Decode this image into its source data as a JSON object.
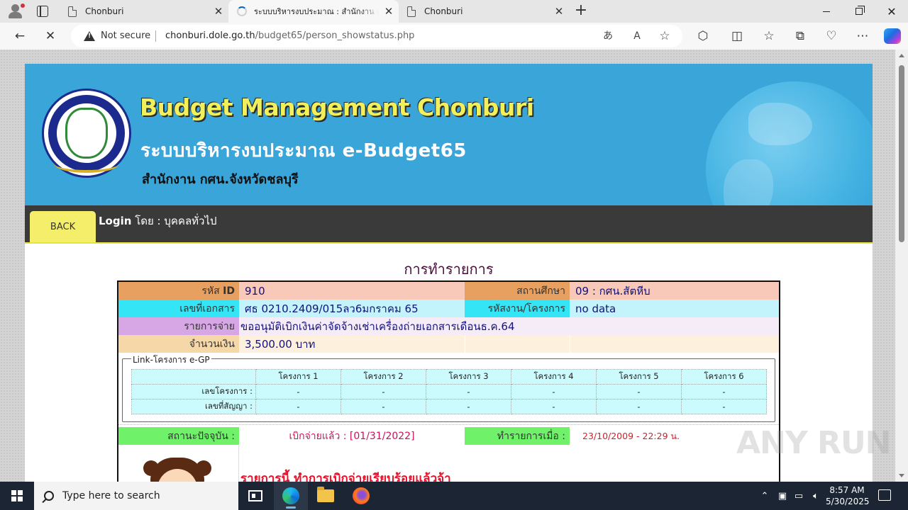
{
  "browser": {
    "tabs": [
      {
        "title": "Chonburi",
        "active": false
      },
      {
        "title": "ระบบบริหารงบประมาณ : สำนักงาน กศน.จังหวัดชลบุรี",
        "active": true
      },
      {
        "title": "Chonburi",
        "active": false
      }
    ],
    "new_tab": "+",
    "address": {
      "security_label": "Not secure",
      "url_host": "chonburi.dole.go.th",
      "url_path": "/budget65/person_showstatus.php"
    },
    "toolbar_icons": [
      "back-icon",
      "stop-icon",
      "read-aloud-icon",
      "immersive-reader-icon",
      "favorite-star-icon",
      "extensions-icon",
      "split-screen-icon",
      "favorites-icon",
      "collections-icon",
      "performance-icon",
      "more-icon",
      "copilot-icon"
    ]
  },
  "site": {
    "title_en": "Budget Management Chonburi",
    "title_th": "ระบบบริหารงบประมาณ e-Budget65",
    "office": "สำนักงาน กศน.จังหวัดชลบุรี",
    "back_label": "BACK",
    "login_label": "Login",
    "login_rest": " โดย : บุคคลทั่วไป",
    "heading": "การทำรายการ"
  },
  "record": {
    "id_label": "รหัส",
    "id_label_strong": "ID",
    "id_value": "910",
    "school_label": "สถานศึกษา",
    "school_value": "09 : กศน.สัตหีบ",
    "doc_label": "เลขที่เอกสาร",
    "doc_value": "ศธ 0210.2409/015ลว6มกราคม 65",
    "project_label": "รหัสงาน/โครงการ",
    "project_value": "no data",
    "expense_label": "รายการจ่าย",
    "expense_value": "ขออนุมัติเบิกเงินค่าจัดจ้างเช่าเครื่องถ่ายเอกสารเดือนธ.ค.64",
    "amount_label": "จำนวนเงิน",
    "amount_value": "3,500.00  บาท"
  },
  "egp": {
    "legend": "Link-โครงการ e-GP",
    "columns": [
      "โครงการ 1",
      "โครงการ 2",
      "โครงการ 3",
      "โครงการ 4",
      "โครงการ 5",
      "โครงการ 6"
    ],
    "rows": [
      {
        "label": "เลขโครงการ :",
        "values": [
          "-",
          "-",
          "-",
          "-",
          "-",
          "-"
        ]
      },
      {
        "label": "เลขที่สัญญา :",
        "values": [
          "-",
          "-",
          "-",
          "-",
          "-",
          "-"
        ]
      }
    ]
  },
  "status": {
    "current_label": "สถานะปัจจุบัน :",
    "current_value": "เบิกจ่ายแล้ว : [01/31/2022]",
    "done_label": "ทำรายการเมื่อ :",
    "done_value": "23/10/2009 - 22:29  น.",
    "message": "รายการนี้ ทำการเบิกจ่ายเรียบร้อยแล้วจ้า"
  },
  "watermark": "ANY RUN",
  "taskbar": {
    "search_placeholder": "Type here to search",
    "time": "8:57 AM",
    "date": "5/30/2025"
  },
  "colors": {
    "banner": "#3aa5d9",
    "title_yellow": "#f2f05a",
    "navbar": "#3a3a3a",
    "back_button": "#f5ee6b",
    "status_green": "#6ff26a",
    "paid_red": "#e8102a"
  }
}
